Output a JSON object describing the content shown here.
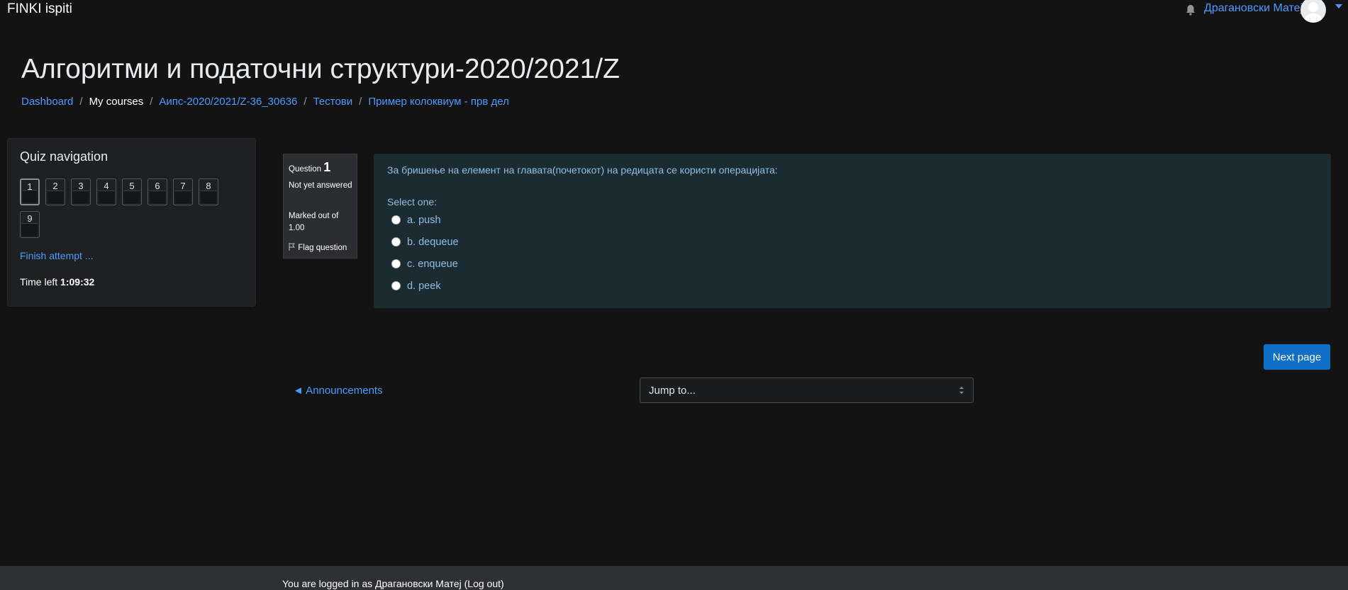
{
  "navbar": {
    "brand": "FINKI ispiti",
    "user_name": "Драгановски Матеј"
  },
  "page": {
    "title": "Алгоритми и податочни структури-2020/2021/Z"
  },
  "breadcrumb": [
    "Dashboard",
    "My courses",
    "Аипс-2020/2021/Z-36_30636",
    "Тестови",
    "Пример колоквиум - прв дел"
  ],
  "quiz_nav": {
    "title": "Quiz navigation",
    "questions": [
      "1",
      "2",
      "3",
      "4",
      "5",
      "6",
      "7",
      "8",
      "9"
    ],
    "current": "1",
    "finish_label": "Finish attempt ...",
    "time_left_label": "Time left",
    "time_left_value": "1:09:32"
  },
  "question_info": {
    "question_label": "Question",
    "number": "1",
    "state": "Not yet answered",
    "grade": "Marked out of 1.00",
    "flag_label": "Flag question"
  },
  "question": {
    "text": "За бришење на елемент на главата(почетокот) на редицата се користи операцијата:",
    "prompt": "Select one:",
    "options": [
      "a. push",
      "b. dequeue",
      "c. enqueue",
      "d. peek"
    ]
  },
  "nav": {
    "next_label": "Next page",
    "prev_activity_label": "◄ Announcements",
    "jump_to_label": "Jump to..."
  },
  "footer": {
    "logged_in_text": "You are logged in as Драгановски Матеј (Log out)"
  },
  "colors": {
    "background": "#131314",
    "link": "#4c9aff",
    "question_bg": "#1c2a32",
    "primary_button": "#0f6fc5"
  }
}
